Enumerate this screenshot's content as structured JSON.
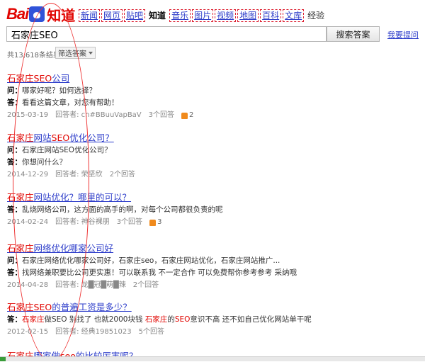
{
  "logo": {
    "bai": "Bai",
    "zhidao": "知道"
  },
  "nav": [
    {
      "label": "新闻",
      "type": "link"
    },
    {
      "label": "网页",
      "type": "link"
    },
    {
      "label": "贴吧",
      "type": "link"
    },
    {
      "label": "知道",
      "type": "active"
    },
    {
      "label": "音乐",
      "type": "link"
    },
    {
      "label": "图片",
      "type": "link"
    },
    {
      "label": "视频",
      "type": "link"
    },
    {
      "label": "地图",
      "type": "link"
    },
    {
      "label": "百科",
      "type": "link"
    },
    {
      "label": "文库",
      "type": "link"
    },
    {
      "label": "经验",
      "type": "plain"
    }
  ],
  "search": {
    "value": "石家庄SEO",
    "button": "搜索答案",
    "ask_link": "我要提问"
  },
  "summary": {
    "count": "共13,618条结果",
    "filter": "筛选答案"
  },
  "results": [
    {
      "title": [
        {
          "t": "石家庄",
          "hl": true
        },
        {
          "t": "SEO",
          "hl": true
        },
        {
          "t": "公司",
          "hl": false
        }
      ],
      "lines": [
        {
          "label": "问：",
          "parts": [
            {
              "t": "哪家好呢？如何选择？",
              "hl": false
            }
          ]
        },
        {
          "label": "答：",
          "parts": [
            {
              "t": "看看这篇文章，对您有帮助！",
              "hl": false
            }
          ]
        }
      ],
      "date": "2015-03-19",
      "answerer": "回答者: cn#BBuuVapBaV",
      "answers": "3个回答",
      "likes": "2"
    },
    {
      "title": [
        {
          "t": "石家庄",
          "hl": true
        },
        {
          "t": "网站",
          "hl": false
        },
        {
          "t": "SEO",
          "hl": true
        },
        {
          "t": "优化公司？",
          "hl": false
        }
      ],
      "lines": [
        {
          "label": "问：",
          "parts": [
            {
              "t": "石家庄网站SEO优化公司？",
              "hl": false
            }
          ]
        },
        {
          "label": "答：",
          "parts": [
            {
              "t": "你想问什么？",
              "hl": false
            }
          ]
        }
      ],
      "date": "2014-12-29",
      "answerer": "回答者: 荣坚欣",
      "answers": "2个回答",
      "likes": ""
    },
    {
      "title": [
        {
          "t": "石家庄",
          "hl": true
        },
        {
          "t": "网站优化？哪里的可以？",
          "hl": false
        }
      ],
      "lines": [
        {
          "label": "答：",
          "parts": [
            {
              "t": "乱烧网络公司，这方面的高手的啊，对每个公司都很负责的呢",
              "hl": false
            }
          ]
        }
      ],
      "date": "2014-02-24",
      "answerer": "回答者: 神谷裸朋",
      "answers": "3个回答",
      "likes": "3"
    },
    {
      "title": [
        {
          "t": "石家庄",
          "hl": true
        },
        {
          "t": "网络优化哪家公司好",
          "hl": false
        }
      ],
      "lines": [
        {
          "label": "问：",
          "parts": [
            {
              "t": "石家庄网络优化哪家公司好，石家庄seo，石家庄网站优化，石家庄网站推广...",
              "hl": false
            }
          ]
        },
        {
          "label": "答：",
          "parts": [
            {
              "t": "找网络兼职要比公司更实惠！可以联系我  不一定合作  可以免费帮你参考参考  采纳哦",
              "hl": false
            }
          ]
        }
      ],
      "date": "2014-04-28",
      "answerer": "回答者: 龙█冠█萌█辣",
      "answers": "2个回答",
      "likes": ""
    },
    {
      "title": [
        {
          "t": "石家庄",
          "hl": true
        },
        {
          "t": "SEO",
          "hl": true
        },
        {
          "t": "的普遍工资是多少？",
          "hl": false
        }
      ],
      "lines": [
        {
          "label": "答：",
          "parts": [
            {
              "t": "石家庄",
              "hl": true
            },
            {
              "t": "做SEO  别找了  也就2000块钱  ",
              "hl": false
            },
            {
              "t": "石家庄",
              "hl": true
            },
            {
              "t": "的",
              "hl": false
            },
            {
              "t": "SEO",
              "hl": true
            },
            {
              "t": "意识不高  还不如自己优化网站单干呢",
              "hl": false
            }
          ]
        }
      ],
      "date": "2012-02-15",
      "answerer": "回答者: 经典19851023",
      "answers": "5个回答",
      "likes": ""
    },
    {
      "title": [
        {
          "t": "石家庄",
          "hl": true
        },
        {
          "t": "哪家做",
          "hl": false
        },
        {
          "t": "seo",
          "hl": true
        },
        {
          "t": "的比较厉害呢？",
          "hl": false
        }
      ],
      "lines": [],
      "date": "",
      "answerer": "",
      "answers": "",
      "likes": ""
    }
  ]
}
